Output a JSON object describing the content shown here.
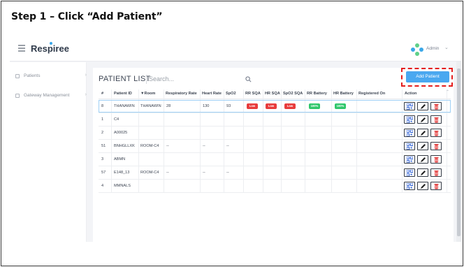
{
  "step_title": "Step 1 – Click “Add Patient”",
  "app": {
    "brand": "Respiree",
    "user_label": "Admin"
  },
  "sidebar": {
    "items": [
      {
        "label": "Patients"
      },
      {
        "label": "Gateway Management"
      }
    ]
  },
  "page": {
    "title": "PATIENT LIST",
    "search_placeholder": "Search...",
    "add_button_label": "Add Patient"
  },
  "table": {
    "headers": {
      "num": "#",
      "patient_id": "Patient ID",
      "room": "▼Room",
      "resp_rate": "Respiratory Rate",
      "heart_rate": "Heart Rate",
      "spo2": "SpO2",
      "rr_sqa": "RR SQA",
      "hr_sqa": "HR SQA",
      "spo2_sqa": "SpO2 SQA",
      "rr_battery": "RR Battery",
      "hr_battery": "HR Battery",
      "registered_on": "Registered On",
      "action": "Action"
    },
    "rows": [
      {
        "num": "8",
        "patient_id": "THANAWIN",
        "room": "THANAWIN",
        "resp_rate": "28",
        "heart_rate": "130",
        "spo2": "93",
        "rr_sqa": "Low",
        "hr_sqa": "Low",
        "spo2_sqa": "Low",
        "rr_battery": "100%",
        "hr_battery": "100%",
        "registered_on": ""
      },
      {
        "num": "1",
        "patient_id": "C4",
        "room": "",
        "resp_rate": "",
        "heart_rate": "",
        "spo2": "",
        "registered_on": ""
      },
      {
        "num": "2",
        "patient_id": "A00025",
        "room": "",
        "resp_rate": "",
        "heart_rate": "",
        "spo2": "",
        "registered_on": ""
      },
      {
        "num": "51",
        "patient_id": "BNHGLLXK",
        "room": "ROOM-C4",
        "resp_rate": "--",
        "heart_rate": "--",
        "spo2": "--",
        "registered_on": ""
      },
      {
        "num": "3",
        "patient_id": "ABMN",
        "room": "",
        "resp_rate": "",
        "heart_rate": "",
        "spo2": "",
        "registered_on": ""
      },
      {
        "num": "57",
        "patient_id": "E148_13",
        "room": "ROOM-C4",
        "resp_rate": "--",
        "heart_rate": "--",
        "spo2": "--",
        "registered_on": ""
      },
      {
        "num": "4",
        "patient_id": "MMNALS",
        "room": "",
        "resp_rate": "",
        "heart_rate": "",
        "spo2": "",
        "registered_on": ""
      }
    ]
  },
  "colors": {
    "accent": "#4aa8f0",
    "highlight": "#e41d1d",
    "badge_low": "#e83c3c",
    "badge_battery": "#2fc76b"
  },
  "icons": [
    "hamburger-icon",
    "admin-avatar-icon",
    "chevron-down-icon",
    "patients-icon",
    "gateway-icon",
    "search-icon",
    "qr-code-icon",
    "edit-pencil-icon",
    "delete-trash-icon"
  ]
}
